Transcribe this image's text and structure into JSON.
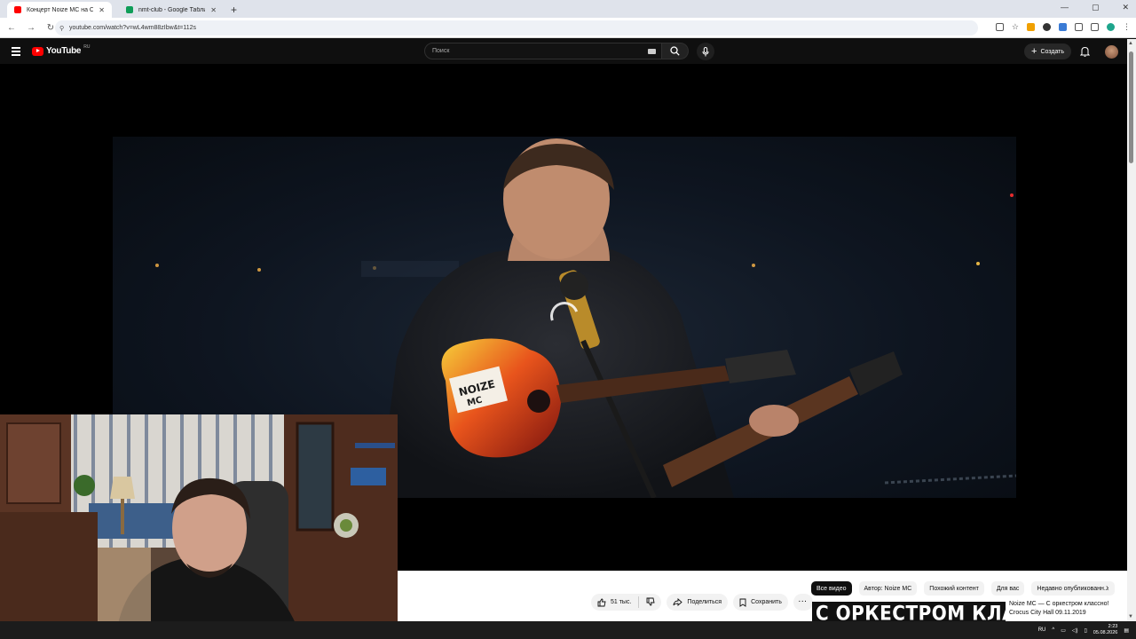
{
  "browser": {
    "tabs": [
      {
        "title": "Концерт Noize MC на Северн",
        "favicon_color": "#ff0000",
        "active": true
      },
      {
        "title": "nmt-club - Google Таблицы",
        "favicon_color": "#0f9d58",
        "active": false
      }
    ],
    "url": "youtube.com/watch?v=wL4wm88zIbw&t=112s"
  },
  "youtube": {
    "logo_text": "YouTube",
    "country_code": "RU",
    "search_placeholder": "Поиск",
    "create_label": "Создать"
  },
  "video": {
    "likes": "51 тыс.",
    "share_label": "Поделиться",
    "save_label": "Сохранить"
  },
  "chips": [
    "Все видео",
    "Автор: Noize MC",
    "Похожий контент",
    "Для вас",
    "Недавно опубликованн..."
  ],
  "recommendation": {
    "thumb_text": "С ОРКЕСТРОМ КЛАССНО!",
    "title": "Noize MC — С оркестром классно!",
    "subtitle": "Crocus City Hall 09.11.2019"
  },
  "taskbar": {
    "lang": "RU",
    "time": "2:23",
    "date": "05.08.2026"
  },
  "colors": {
    "accent": "#ff0000",
    "bg": "#0f0f0f"
  }
}
